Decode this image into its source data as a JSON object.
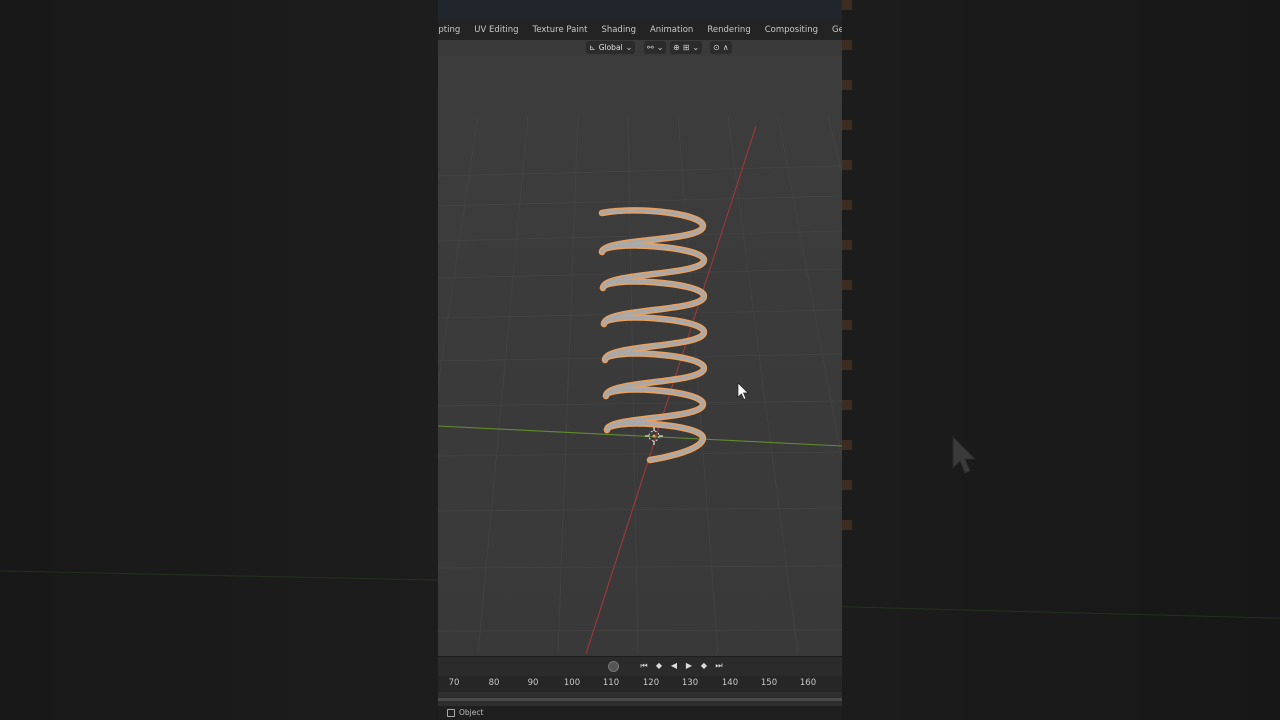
{
  "workspace_tabs": [
    "lpting",
    "UV Editing",
    "Texture Paint",
    "Shading",
    "Animation",
    "Rendering",
    "Compositing",
    "Geometry N"
  ],
  "header": {
    "transform_orientation": "Global"
  },
  "timeline": {
    "ticks": [
      "70",
      "80",
      "90",
      "100",
      "110",
      "120",
      "130",
      "140",
      "150",
      "160"
    ]
  },
  "status": {
    "mode_label": "Object"
  },
  "icons": {
    "orientation": "transform-orientation-icon",
    "snap": "snap-icon",
    "proportional": "proportional-edit-icon",
    "play": "play-icon"
  },
  "colors": {
    "selection_outline": "#e8a060",
    "x_axis": "#b03838",
    "y_axis": "#6a9a2e",
    "viewport_bg": "#3b3b3b"
  }
}
